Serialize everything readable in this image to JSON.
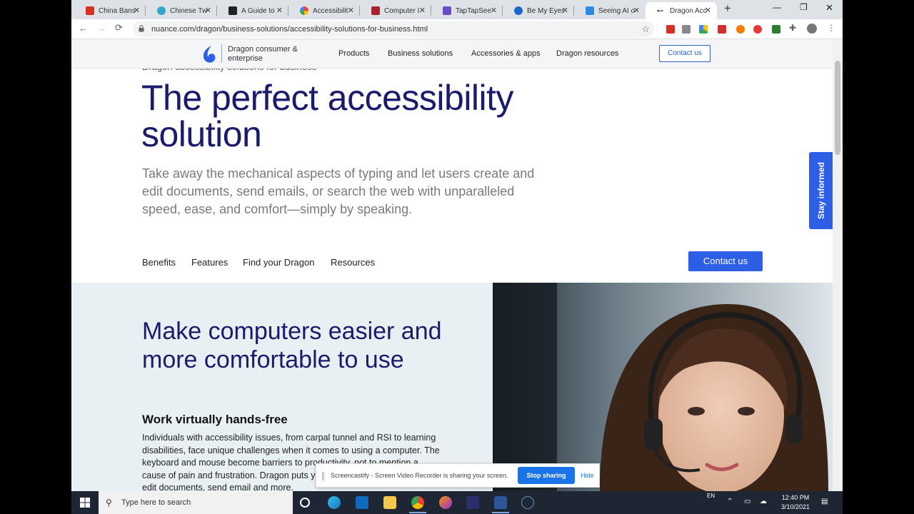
{
  "browser": {
    "tabs": [
      {
        "label": "China Bans",
        "color": "#d93025",
        "active": false
      },
      {
        "label": "Chinese Tw",
        "color": "#34a8c9",
        "active": false
      },
      {
        "label": "A Guide to",
        "color": "#222222",
        "active": false
      },
      {
        "label": "Accessibilit",
        "color": "#4285f4",
        "active": false
      },
      {
        "label": "Computer I",
        "color": "#a8212f",
        "active": false
      },
      {
        "label": "TapTapSee",
        "color": "#6b4cc7",
        "active": false
      },
      {
        "label": "Be My Eyes",
        "color": "#1b66c9",
        "active": false
      },
      {
        "label": "Seeing AI o",
        "color": "#2b8be0",
        "active": false
      },
      {
        "label": "Dragon Acc",
        "color": "#1a1b6d",
        "active": true
      }
    ],
    "new_tab": "+",
    "url": "nuance.com/dragon/business-solutions/accessibility-solutions-for-business.html",
    "controls": {
      "back": "←",
      "forward": "→",
      "reload": "⟳",
      "star": "☆",
      "minimize": "—",
      "restore": "❐",
      "close": "✕"
    }
  },
  "site": {
    "brand": "Dragon consumer & enterprise",
    "nav": [
      "Products",
      "Business solutions",
      "Accessories & apps",
      "Dragon resources"
    ],
    "nav_contact": "Contact us",
    "eyebrow": "Dragon accessibility solutions for business",
    "hero_title": "The perfect accessibility solution",
    "hero_sub": "Take away the mechanical aspects of typing and let users create and edit documents, send emails, or search the web with unparalleled speed, ease, and comfort—simply by speaking.",
    "subnav": [
      "Benefits",
      "Features",
      "Find your Dragon",
      "Resources"
    ],
    "contact_button": "Contact us",
    "stay_informed": "Stay informed",
    "section2": {
      "title": "Make computers easier and more comfortable to use",
      "subtitle": "Work virtually hands-free",
      "body": "Individuals with accessibility issues, from carpal tunnel and RSI to learning disabilities, face unique challenges when it comes to using a computer. The keyboard and mouse become barriers to productivity, not to mention a cause of pain and frustration. Dragon puts your voice to work to create and edit documents, send email and more."
    }
  },
  "screencastify": {
    "message": "Screencastify - Screen Video Recorder is sharing your screen.",
    "stop": "Stop sharing",
    "hide": "Hide"
  },
  "taskbar": {
    "search_placeholder": "Type here to search",
    "lang": "EN",
    "time": "12:40 PM",
    "date": "3/10/2021"
  },
  "colors": {
    "navy": "#1a1b6d",
    "accent_blue": "#2c5ee6",
    "section_bg": "#e9f0f3"
  }
}
